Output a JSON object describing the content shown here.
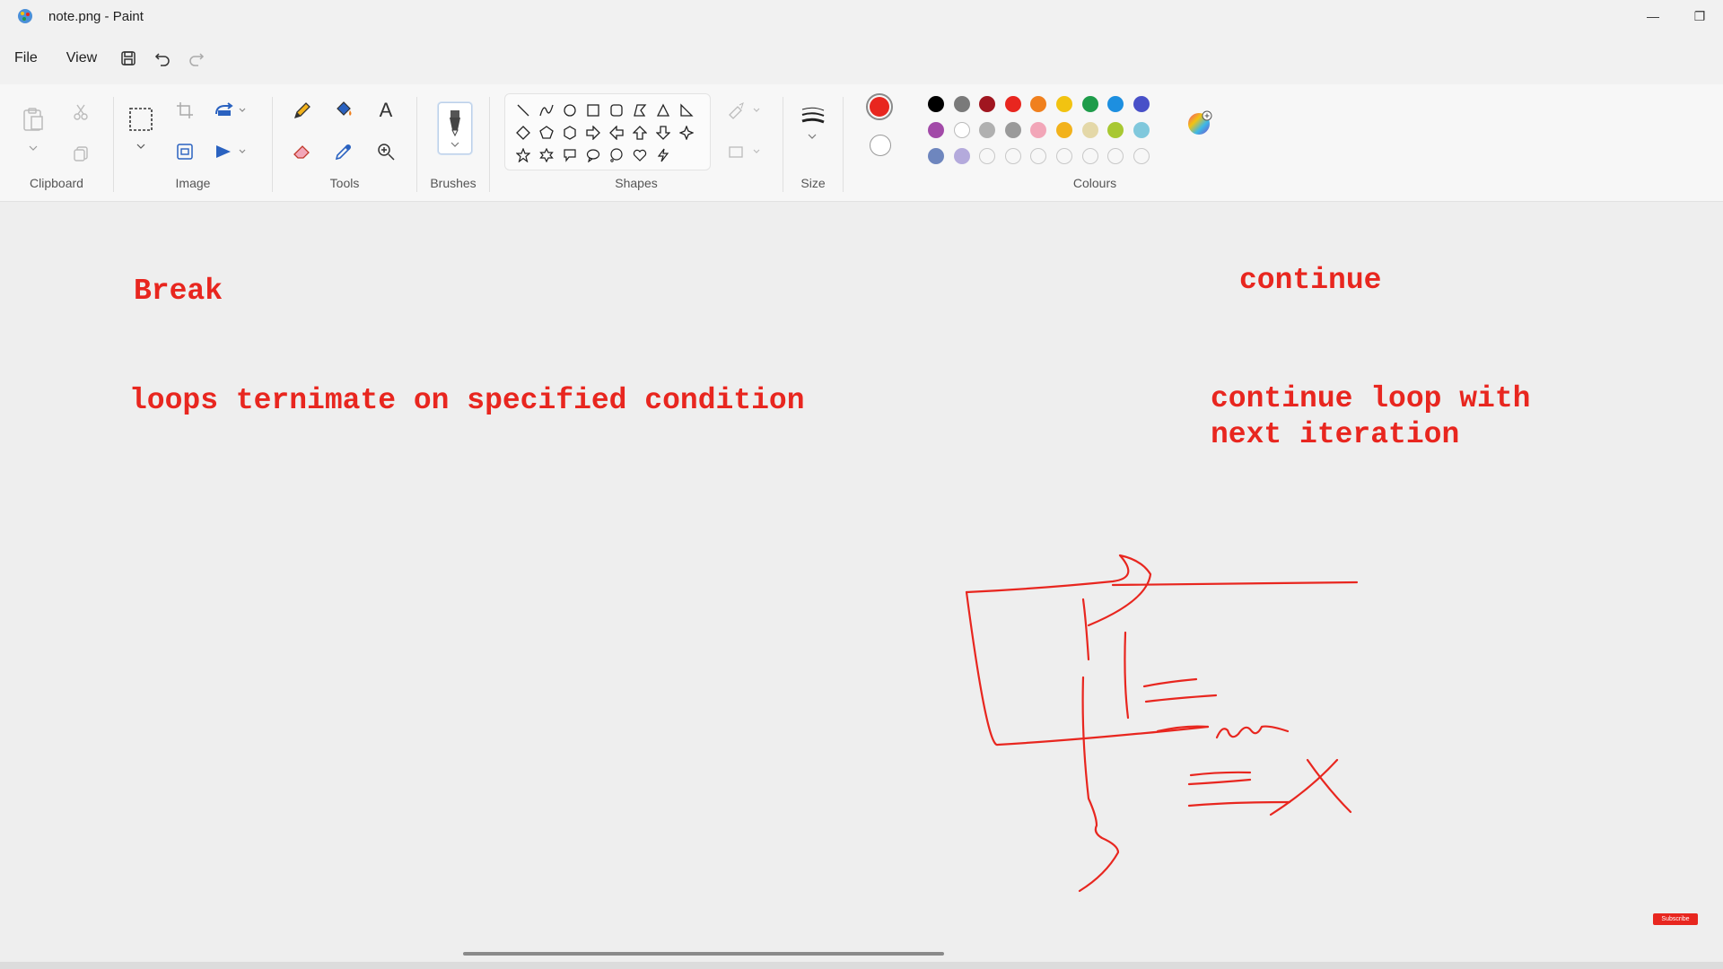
{
  "window": {
    "title": "note.png - Paint",
    "minimize_label": "—",
    "restore_label": "❐"
  },
  "menu": {
    "file": "File",
    "view": "View"
  },
  "ribbon": {
    "groups": {
      "clipboard": "Clipboard",
      "image": "Image",
      "tools": "Tools",
      "brushes": "Brushes",
      "shapes": "Shapes",
      "size": "Size",
      "colours": "Colours"
    },
    "tools_text_label": "A",
    "primary_colour": "#e8261f",
    "secondary_colour": "#ffffff",
    "palette_row1": [
      "#000000",
      "#7a7a7a",
      "#a01620",
      "#e8261f",
      "#f0801e",
      "#f2c311",
      "#1e9c4a",
      "#1d8fe0",
      "#4850c8"
    ],
    "palette_row2": [
      "#a24aa8",
      "#ffffff",
      "#b0b0b0",
      "#9a9a9a",
      "#f2a6b8",
      "#f2b21c",
      "#e4d8a8",
      "#a8c832",
      "#80c8dc"
    ],
    "palette_row3": [
      "#6e86be",
      "#b4aadc"
    ]
  },
  "canvas": {
    "notes": {
      "break_title": "Break",
      "break_desc": "loops ternimate on specified condition",
      "continue_title": "continue",
      "continue_desc": "continue loop with\nnext iteration"
    },
    "ink_colour": "#e8261f"
  },
  "overlay": {
    "subscribe_badge": "Subscribe"
  }
}
